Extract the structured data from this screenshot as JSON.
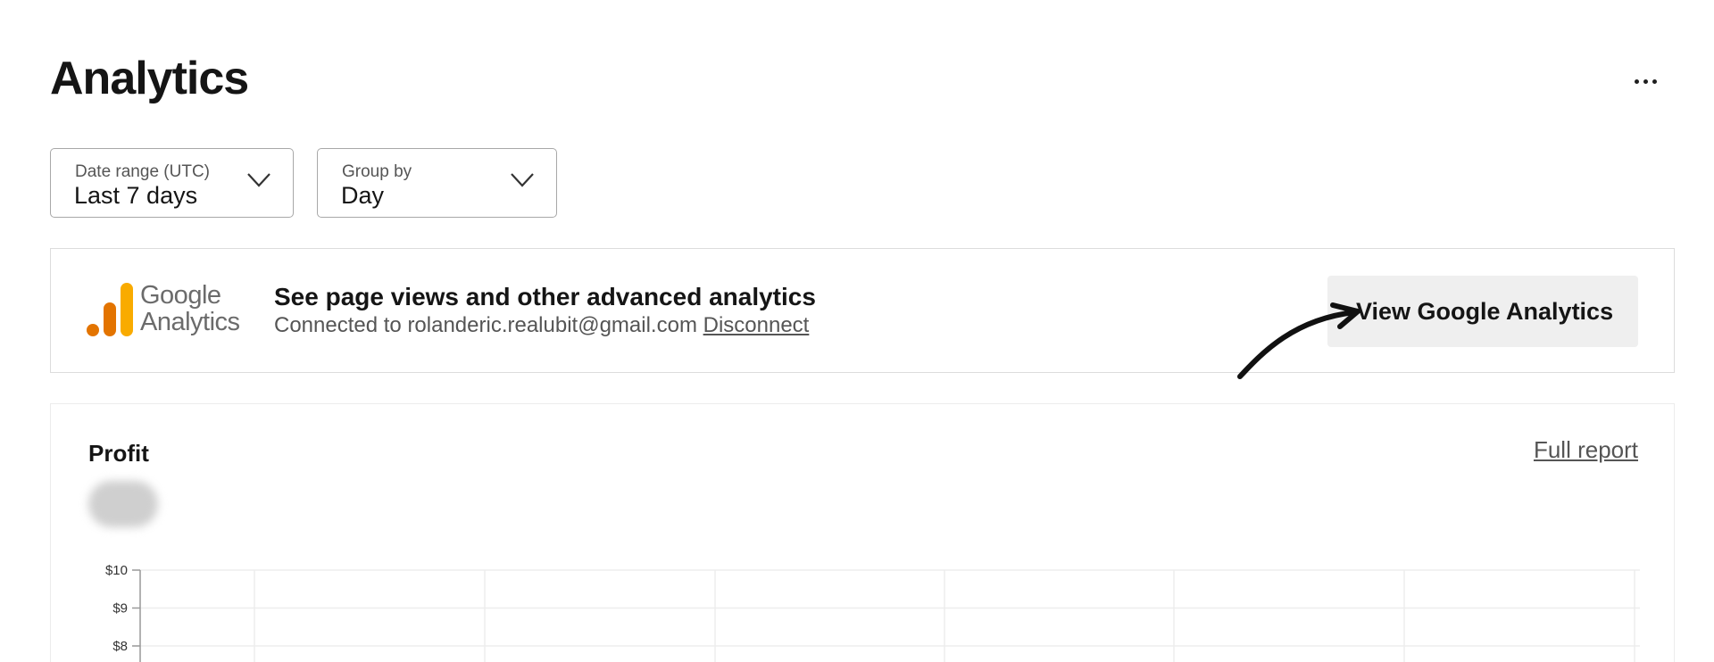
{
  "page": {
    "title": "Analytics",
    "more_icon": "more-horizontal-icon"
  },
  "filters": {
    "date_range": {
      "label": "Date range (UTC)",
      "value": "Last 7 days",
      "icon": "chevron-down-icon"
    },
    "group_by": {
      "label": "Group by",
      "value": "Day",
      "icon": "chevron-down-icon"
    }
  },
  "google_analytics": {
    "logo_line1": "Google",
    "logo_line2": "Analytics",
    "heading": "See page views and other advanced analytics",
    "connected_text": "Connected to rolanderic.realubit@gmail.com",
    "disconnect_label": "Disconnect",
    "button_label": "View Google Analytics",
    "colors": {
      "bar_dark": "#E37400",
      "bar_light": "#F9AB00"
    }
  },
  "profit": {
    "title": "Profit",
    "full_report_label": "Full report",
    "value_hidden": true
  },
  "chart_data": {
    "type": "line",
    "title": "",
    "xlabel": "",
    "ylabel": "",
    "y_ticks": [
      "$10",
      "$9",
      "$8"
    ],
    "ylim": [
      8,
      10
    ],
    "grid": true,
    "series": []
  }
}
